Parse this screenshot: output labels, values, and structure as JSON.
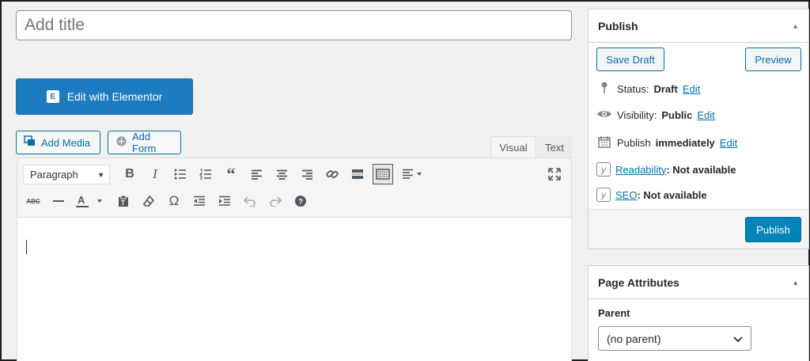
{
  "title": {
    "placeholder": "Add title"
  },
  "elementor": {
    "label": "Edit with Elementor",
    "logo": "E"
  },
  "media": {
    "add_media": "Add Media",
    "add_form": "Add Form"
  },
  "tabs": {
    "visual": "Visual",
    "text": "Text"
  },
  "toolbar": {
    "format_value": "Paragraph",
    "row1_icons": [
      "bold-icon",
      "italic-icon",
      "bullet-list-icon",
      "numbered-list-icon",
      "blockquote-icon",
      "align-left-icon",
      "align-center-icon",
      "align-right-icon",
      "link-icon",
      "read-more-icon",
      "toolbar-toggle-icon",
      "align-dropdown-icon"
    ],
    "row2_icons": [
      "strikethrough-icon",
      "horizontal-line-icon",
      "text-color-icon",
      "paste-text-icon",
      "clear-formatting-icon",
      "special-character-icon",
      "outdent-icon",
      "indent-icon",
      "undo-icon",
      "redo-icon",
      "help-icon"
    ],
    "fullscreen_icon": "fullscreen-icon"
  },
  "publish": {
    "title": "Publish",
    "save_draft": "Save Draft",
    "preview": "Preview",
    "status_label": "Status:",
    "status_value": "Draft",
    "visibility_label": "Visibility:",
    "visibility_value": "Public",
    "publish_label": "Publish",
    "publish_value": "immediately",
    "edit": "Edit",
    "readability_link": "Readability",
    "readability_value": ": Not available",
    "seo_link": "SEO",
    "seo_value": ": Not available",
    "publish_button": "Publish"
  },
  "page_attributes": {
    "title": "Page Attributes",
    "parent_label": "Parent",
    "parent_value": "(no parent)"
  }
}
